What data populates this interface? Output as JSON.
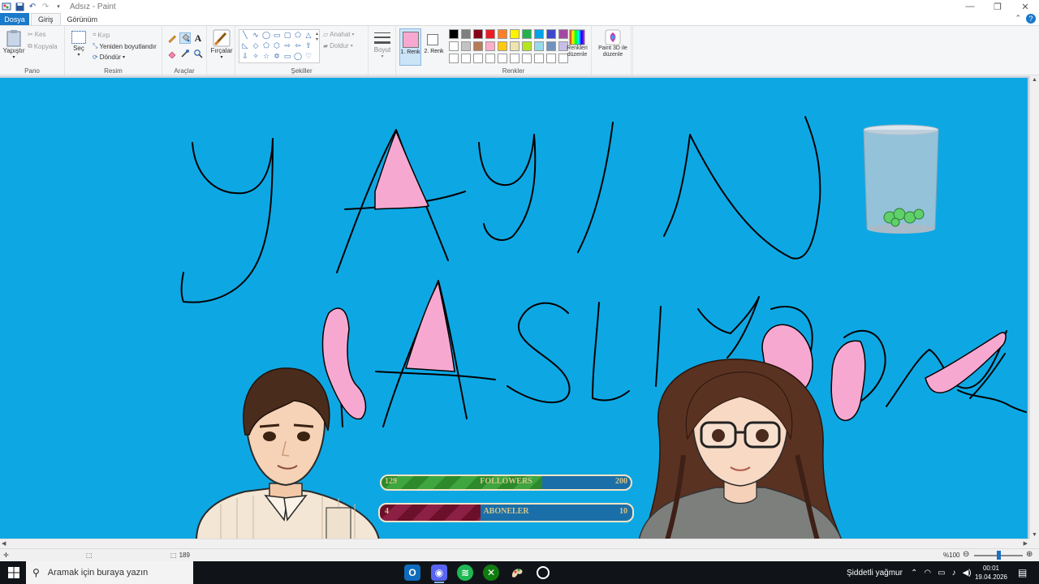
{
  "window": {
    "title": "Adsız - Paint",
    "minimize": "—",
    "maximize": "❐",
    "close": "✕"
  },
  "tabs": [
    {
      "label": "Dosya"
    },
    {
      "label": "Giriş"
    },
    {
      "label": "Görünüm"
    }
  ],
  "ribbon": {
    "pano": {
      "label": "Pano",
      "paste": "Yapıştır",
      "cut": "Kes",
      "copy": "Kopyala"
    },
    "resim": {
      "label": "Resim",
      "select": "Seç",
      "crop": "Kırp",
      "resize": "Yeniden boyutlandır",
      "rotate": "Döndür"
    },
    "araclar": {
      "label": "Araçlar",
      "text_tool": "A"
    },
    "brushes": {
      "label": "Fırçalar"
    },
    "sekiller": {
      "label": "Şekiller",
      "outline": "Anahat",
      "fill": "Doldur"
    },
    "boyut": {
      "label": "Boyut"
    },
    "renkler": {
      "label": "Renkler",
      "color1": "1. Renk",
      "color2": "2. Renk",
      "edit_colors": "Renkleri düzenle",
      "paint3d": "Paint 3D ile düzenle",
      "color1_value": "#f7a8d0",
      "color2_value": "#ffffff",
      "palette_row1": [
        "#000000",
        "#7f7f7f",
        "#880015",
        "#ed1c24",
        "#ff7f27",
        "#fff200",
        "#22b14c",
        "#00a2e8",
        "#3f48cc",
        "#a349a4"
      ],
      "palette_row2": [
        "#ffffff",
        "#c3c3c3",
        "#b97a57",
        "#ffaec9",
        "#ffc90e",
        "#efe4b0",
        "#b5e61d",
        "#99d9ea",
        "#7092be",
        "#c8bfe7"
      ]
    }
  },
  "overlay": {
    "followers": {
      "current": "129",
      "label": "FOLLOWERS",
      "goal": "200",
      "progress": 0.645
    },
    "aboneler": {
      "current": "4",
      "label": "ABONELER",
      "goal": "10",
      "progress": 0.4
    }
  },
  "statusbar": {
    "size_partial": "189",
    "zoom": "%100"
  },
  "taskbar": {
    "search_placeholder": "Aramak için buraya yazın",
    "weather": "Şiddetli yağmur",
    "time": "00:01",
    "date": "19.04.2026"
  }
}
